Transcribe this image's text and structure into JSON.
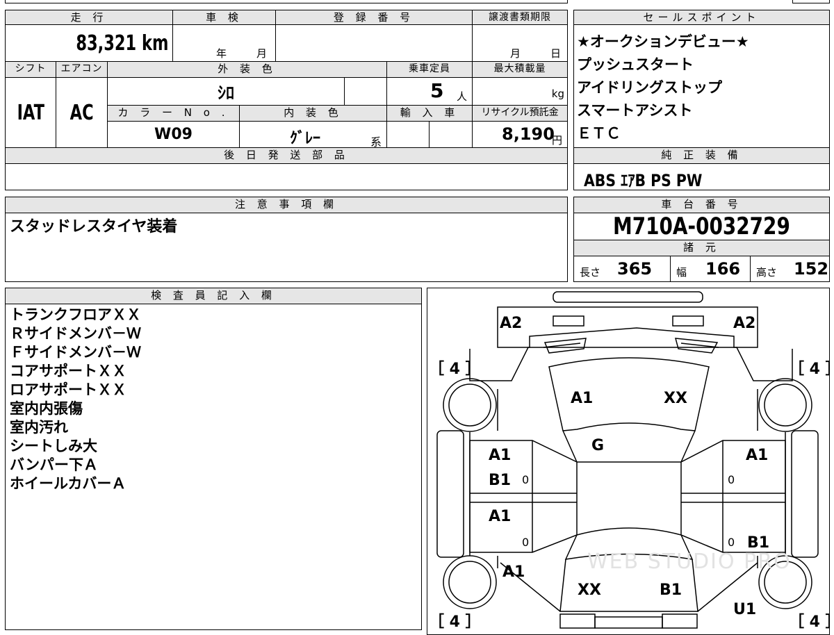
{
  "vehicle_info": {
    "mileage_label": "走 行",
    "mileage_value": "83,321 km",
    "inspection_label": "車 検",
    "inspection_year_unit": "年",
    "inspection_month_unit": "月",
    "registration_label": "登 録 番 号",
    "transfer_deadline_label": "譲渡書類期限",
    "transfer_month_unit": "月",
    "transfer_day_unit": "日",
    "shift_label": "シフト",
    "shift_value": "IAT",
    "ac_label": "エアコン",
    "ac_value": "AC",
    "exterior_color_label": "外 装 色",
    "exterior_color_value": "ｼﾛ",
    "color_no_label": "カ ラ ー N o .",
    "color_no_value": "W09",
    "interior_color_label": "内 装 色",
    "interior_color_value": "ｸﾞﾚｰ",
    "interior_color_suffix": "系",
    "capacity_label": "乗車定員",
    "capacity_value": "5",
    "capacity_unit": "人",
    "max_load_label": "最大積載量",
    "max_load_unit": "kg",
    "import_label": "輸 入 車",
    "recycle_label": "リサイクル預託金",
    "recycle_value": "8,190",
    "recycle_unit": "円",
    "later_parts_label": "後 日 発 送 部 品"
  },
  "sales_points": {
    "header": "セールスポイント",
    "items": [
      "★オークションデビュー★",
      "プッシュスタート",
      "アイドリングストップ",
      "スマートアシスト",
      "ＥＴＣ"
    ]
  },
  "equipment": {
    "header": "純 正 装 備",
    "value": "ABS ｴｱB PS PW"
  },
  "notes": {
    "header": "注 意 事 項 欄",
    "value": "スタッドレスタイヤ装着"
  },
  "chassis": {
    "header": "車 台 番 号",
    "value": "M710A-0032729",
    "specs_header": "諸 元",
    "length_label": "長さ",
    "length_value": "365",
    "width_label": "幅",
    "width_value": "166",
    "height_label": "高さ",
    "height_value": "152"
  },
  "inspector": {
    "header": "検 査 員 記 入 欄",
    "items": [
      "トランクフロアＸＸ",
      "Ｒサイドメンバ－Ｗ",
      "Ｆサイドメンバ－Ｗ",
      "コアサポートＸＸ",
      "ロアサポートＸＸ",
      "室内内張傷",
      "室内汚れ",
      "シートしみ大",
      "バンパー下Ａ",
      "ホイールカバーＡ"
    ]
  },
  "diagram": {
    "tire_tl": "［ 4 ］",
    "tire_tr": "［ 4 ］",
    "tire_bl": "［ 4 ］",
    "tire_br": "［ 4 ］",
    "rear_left": "A2",
    "rear_right": "A2",
    "roof_left": "A1",
    "roof_right": "XX",
    "glass": "G",
    "left_rear_door_1": "A1",
    "left_rear_door_2": "B1",
    "left_front_door": "A1",
    "left_fender": "A1",
    "right_rear_door": "A1",
    "right_front_door": "B1",
    "hood_left": "XX",
    "hood_right": "B1",
    "front_right": "U1",
    "zero_1": "0",
    "zero_2": "0",
    "zero_3": "0",
    "zero_4": "0",
    "watermark": "WEB STUDIO PRO"
  }
}
